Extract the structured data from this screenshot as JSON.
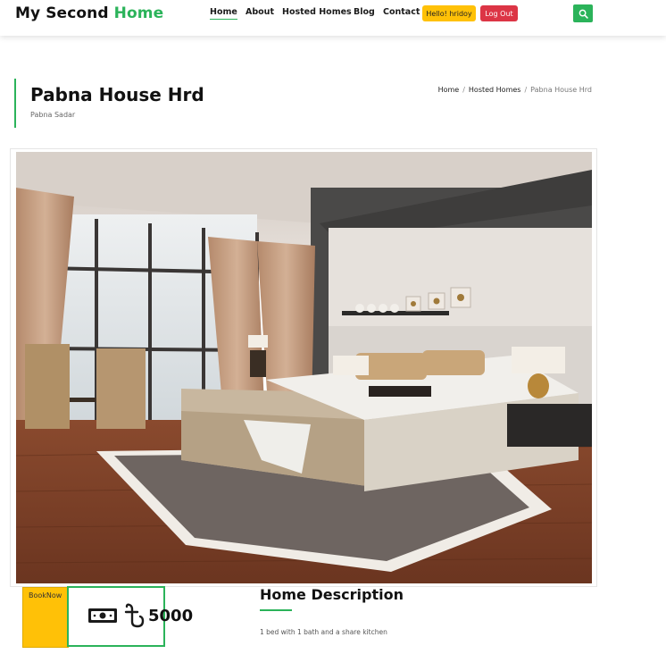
{
  "brand": {
    "part1": "My Second",
    "part2": "Home",
    "accent": "#2bb35a"
  },
  "nav": [
    {
      "label": "Home",
      "active": true
    },
    {
      "label": "About",
      "active": false
    },
    {
      "label": "Hosted Homes",
      "active": false
    },
    {
      "label": "Blog",
      "active": false
    },
    {
      "label": "Contact",
      "active": false
    }
  ],
  "user": {
    "greeting": "Hello! hridoy",
    "logout_label": "Log Out"
  },
  "search": {
    "icon": "search-icon"
  },
  "page": {
    "title": "Pabna House Hrd",
    "subtitle": "Pabna Sadar"
  },
  "breadcrumb": [
    {
      "label": "Home"
    },
    {
      "label": "Hosted Homes"
    },
    {
      "label": "Pabna House Hrd"
    }
  ],
  "listing": {
    "book_label": "BookNow",
    "price_icon": "banknote-icon",
    "currency_icon": "taka-sign-icon",
    "price": "5000",
    "description_title": "Home Description",
    "description": "1 bed with 1 bath and a share kitchen"
  },
  "colors": {
    "yellow": "#ffc107",
    "red": "#dc3545",
    "green": "#2bb35a"
  }
}
